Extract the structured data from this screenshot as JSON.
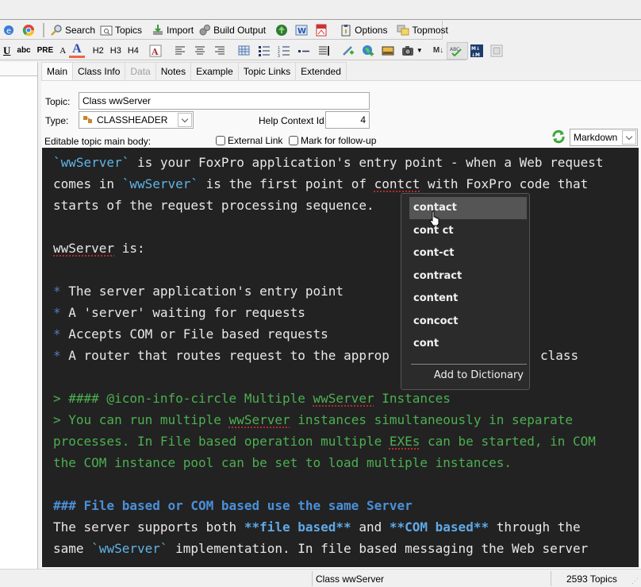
{
  "toolbar1": {
    "items": [
      {
        "icon": "ie-icon"
      },
      {
        "icon": "chrome-icon"
      },
      {
        "label": "Search",
        "icon": "search-icon"
      },
      {
        "label": "Topics",
        "icon": "topics-icon"
      },
      {
        "label": "Import",
        "icon": "import-icon"
      },
      {
        "label": "Build Output",
        "icon": "gears-icon"
      },
      {
        "icon": "globe-upload-icon"
      },
      {
        "icon": "word-icon"
      },
      {
        "icon": "pdf-icon"
      },
      {
        "label": "Options",
        "icon": "clipboard-icon"
      },
      {
        "label": "Topmost",
        "icon": "windows-stack-icon"
      }
    ]
  },
  "toolbar2": {
    "format": {
      "underline": "U",
      "strike": "abc",
      "pre": "PRE",
      "fontsize": "A",
      "fontcolor": "A",
      "h2": "H2",
      "h3": "H3",
      "h4": "H4",
      "markdown_toggle": "M↓"
    }
  },
  "tabs": [
    {
      "label": "Main",
      "active": true
    },
    {
      "label": "Class Info"
    },
    {
      "label": "Data",
      "disabled": true
    },
    {
      "label": "Notes"
    },
    {
      "label": "Example"
    },
    {
      "label": "Topic Links"
    },
    {
      "label": "Extended"
    }
  ],
  "form": {
    "topic_label": "Topic:",
    "topic_value": "Class wwServer",
    "type_label": "Type:",
    "type_value": "CLASSHEADER",
    "help_context_label": "Help Context Id:",
    "help_context_value": "4",
    "body_label": "Editable topic main body:",
    "external_link_label": "External Link",
    "follow_up_label": "Mark for follow-up",
    "editor_mode": "Markdown"
  },
  "editor": {
    "lines": {
      "l1a": "`wwServer`",
      "l1b": " is your FoxPro application's entry point - when a Web request",
      "l2a": "comes in ",
      "l2b": "`wwServer`",
      "l2c": " is the first point of ",
      "l2d": "contct",
      "l2e": " with FoxPro code that",
      "l3": "starts of the request processing sequence.",
      "l5a": "wwServer",
      "l5b": " is:",
      "b1": "The server application's entry point",
      "b2": "A 'server' waiting for requests",
      "b3": "Accepts COM or File based requests",
      "b4a": "A router that routes request to the approp",
      "b4b": "class",
      "q1a": "> #### @icon-info-circle Multiple ",
      "q1b": "wwServer",
      "q1c": " Instances",
      "q2a": "> You can run multiple ",
      "q2b": "wwServer",
      "q2c": " instances simultaneously in separate",
      "q3a": "processes. In File based operation multiple ",
      "q3b": "EXEs",
      "q3c": " can be started, in COM",
      "q4": "the COM instance pool can be set to load multiple instances.",
      "h3": "### File based or COM based use the same Server",
      "p1a": "The server supports both ",
      "p1b": "**file based**",
      "p1c": " and ",
      "p1d": "**COM based**",
      "p1e": " through the",
      "p2a": "same ",
      "p2b": "`wwServer`",
      "p2c": " implementation. In file based messaging the Web server",
      "bullet": "*"
    }
  },
  "spell_popup": {
    "suggestions": [
      "contact",
      "cont ct",
      "cont-ct",
      "contract",
      "content",
      "concoct",
      "cont"
    ],
    "add_label": "Add to Dictionary"
  },
  "status": {
    "topic": "Class wwServer",
    "count": "2593 Topics"
  }
}
